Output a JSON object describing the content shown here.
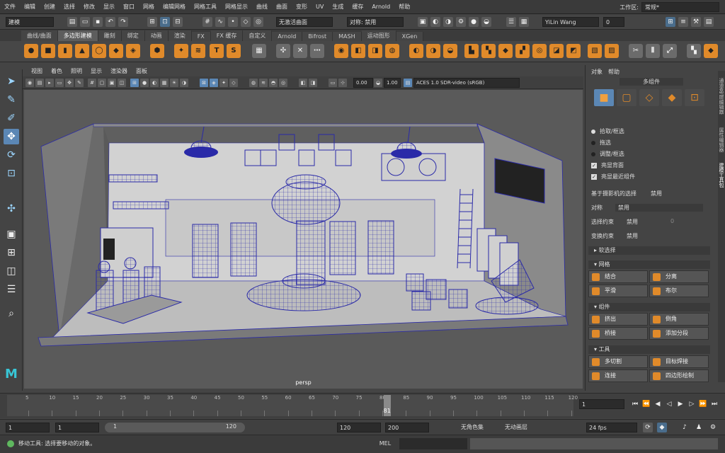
{
  "menubar": {
    "items": [
      "文件",
      "编辑",
      "创建",
      "选择",
      "修改",
      "显示",
      "窗口",
      "网格",
      "编辑网格",
      "网格工具",
      "网格显示",
      "曲线",
      "曲面",
      "变形",
      "UV",
      "生成",
      "缓存",
      "Arnold",
      "帮助"
    ],
    "workspace_label": "工作区:",
    "workspace_value": "常规*"
  },
  "statusline": {
    "mode": "建模",
    "surface": "无激活曲面",
    "symmetry": "对称: 禁用",
    "user": "YiLin Wang",
    "notify_count": "0"
  },
  "shelf": {
    "tabs": [
      "曲线/曲面",
      "多边形建模",
      "雕刻",
      "绑定",
      "动画",
      "渲染",
      "FX",
      "FX 缓存",
      "自定义",
      "Arnold",
      "Bifrost",
      "MASH",
      "运动图形",
      "XGen"
    ],
    "active_tab": 1
  },
  "viewport": {
    "menu": [
      "视图",
      "着色",
      "照明",
      "显示",
      "渲染器",
      "面板"
    ],
    "val1": "0.00",
    "val2": "1.00",
    "colorspace": "ACES 1.0 SDR-video (sRGB)",
    "camera": "persp",
    "colors": {
      "bg": "#5b5b5b",
      "wire": "#2020a0",
      "shell": "#8a8a8a",
      "ortho": "#cfcfcf"
    }
  },
  "rightpanel": {
    "menu": [
      "对象",
      "帮助"
    ],
    "mode_title": "多组件",
    "radio": [
      "拾取/框选",
      "拖选",
      "调整/框选"
    ],
    "checks": [
      "亮显背面",
      "亮显最近组件"
    ],
    "camera_sel": {
      "label": "基于摄影机的选择",
      "value": "禁用"
    },
    "symmetry": {
      "label": "对称",
      "value": "禁用"
    },
    "sel_constraint": {
      "label": "选择约束",
      "value": "禁用",
      "num": "0"
    },
    "xform_constraint": {
      "label": "变换约束",
      "value": "禁用"
    },
    "soft_select": "软选择",
    "sections": [
      {
        "title": "网格",
        "buttons": [
          "结合",
          "分离",
          "平滑",
          "布尔"
        ]
      },
      {
        "title": "组件",
        "buttons": [
          "挤出",
          "倒角",
          "桥接",
          "添加分段"
        ]
      },
      {
        "title": "工具",
        "buttons": [
          "多切割",
          "目标焊接",
          "连接",
          "四边形绘制"
        ]
      }
    ],
    "vtabs": [
      "通道盒/层编辑器",
      "属性编辑器",
      "建模工具包"
    ]
  },
  "timeline": {
    "ticks": [
      "5",
      "10",
      "15",
      "20",
      "25",
      "30",
      "35",
      "40",
      "45",
      "50",
      "55",
      "60",
      "65",
      "70",
      "75",
      "80",
      "85",
      "90",
      "95",
      "100",
      "105",
      "110",
      "115",
      "120"
    ],
    "current": "81",
    "current_frame_field": "1"
  },
  "range": {
    "start": "1",
    "anim_start": "1",
    "slider_start": "1",
    "slider_end": "120",
    "end": "120",
    "anim_end": "200",
    "charset": "无角色集",
    "layer": "无动画层",
    "fps": "24 fps"
  },
  "cmdline": {
    "help": "移动工具: 选择要移动的对象。",
    "lang": "MEL"
  }
}
